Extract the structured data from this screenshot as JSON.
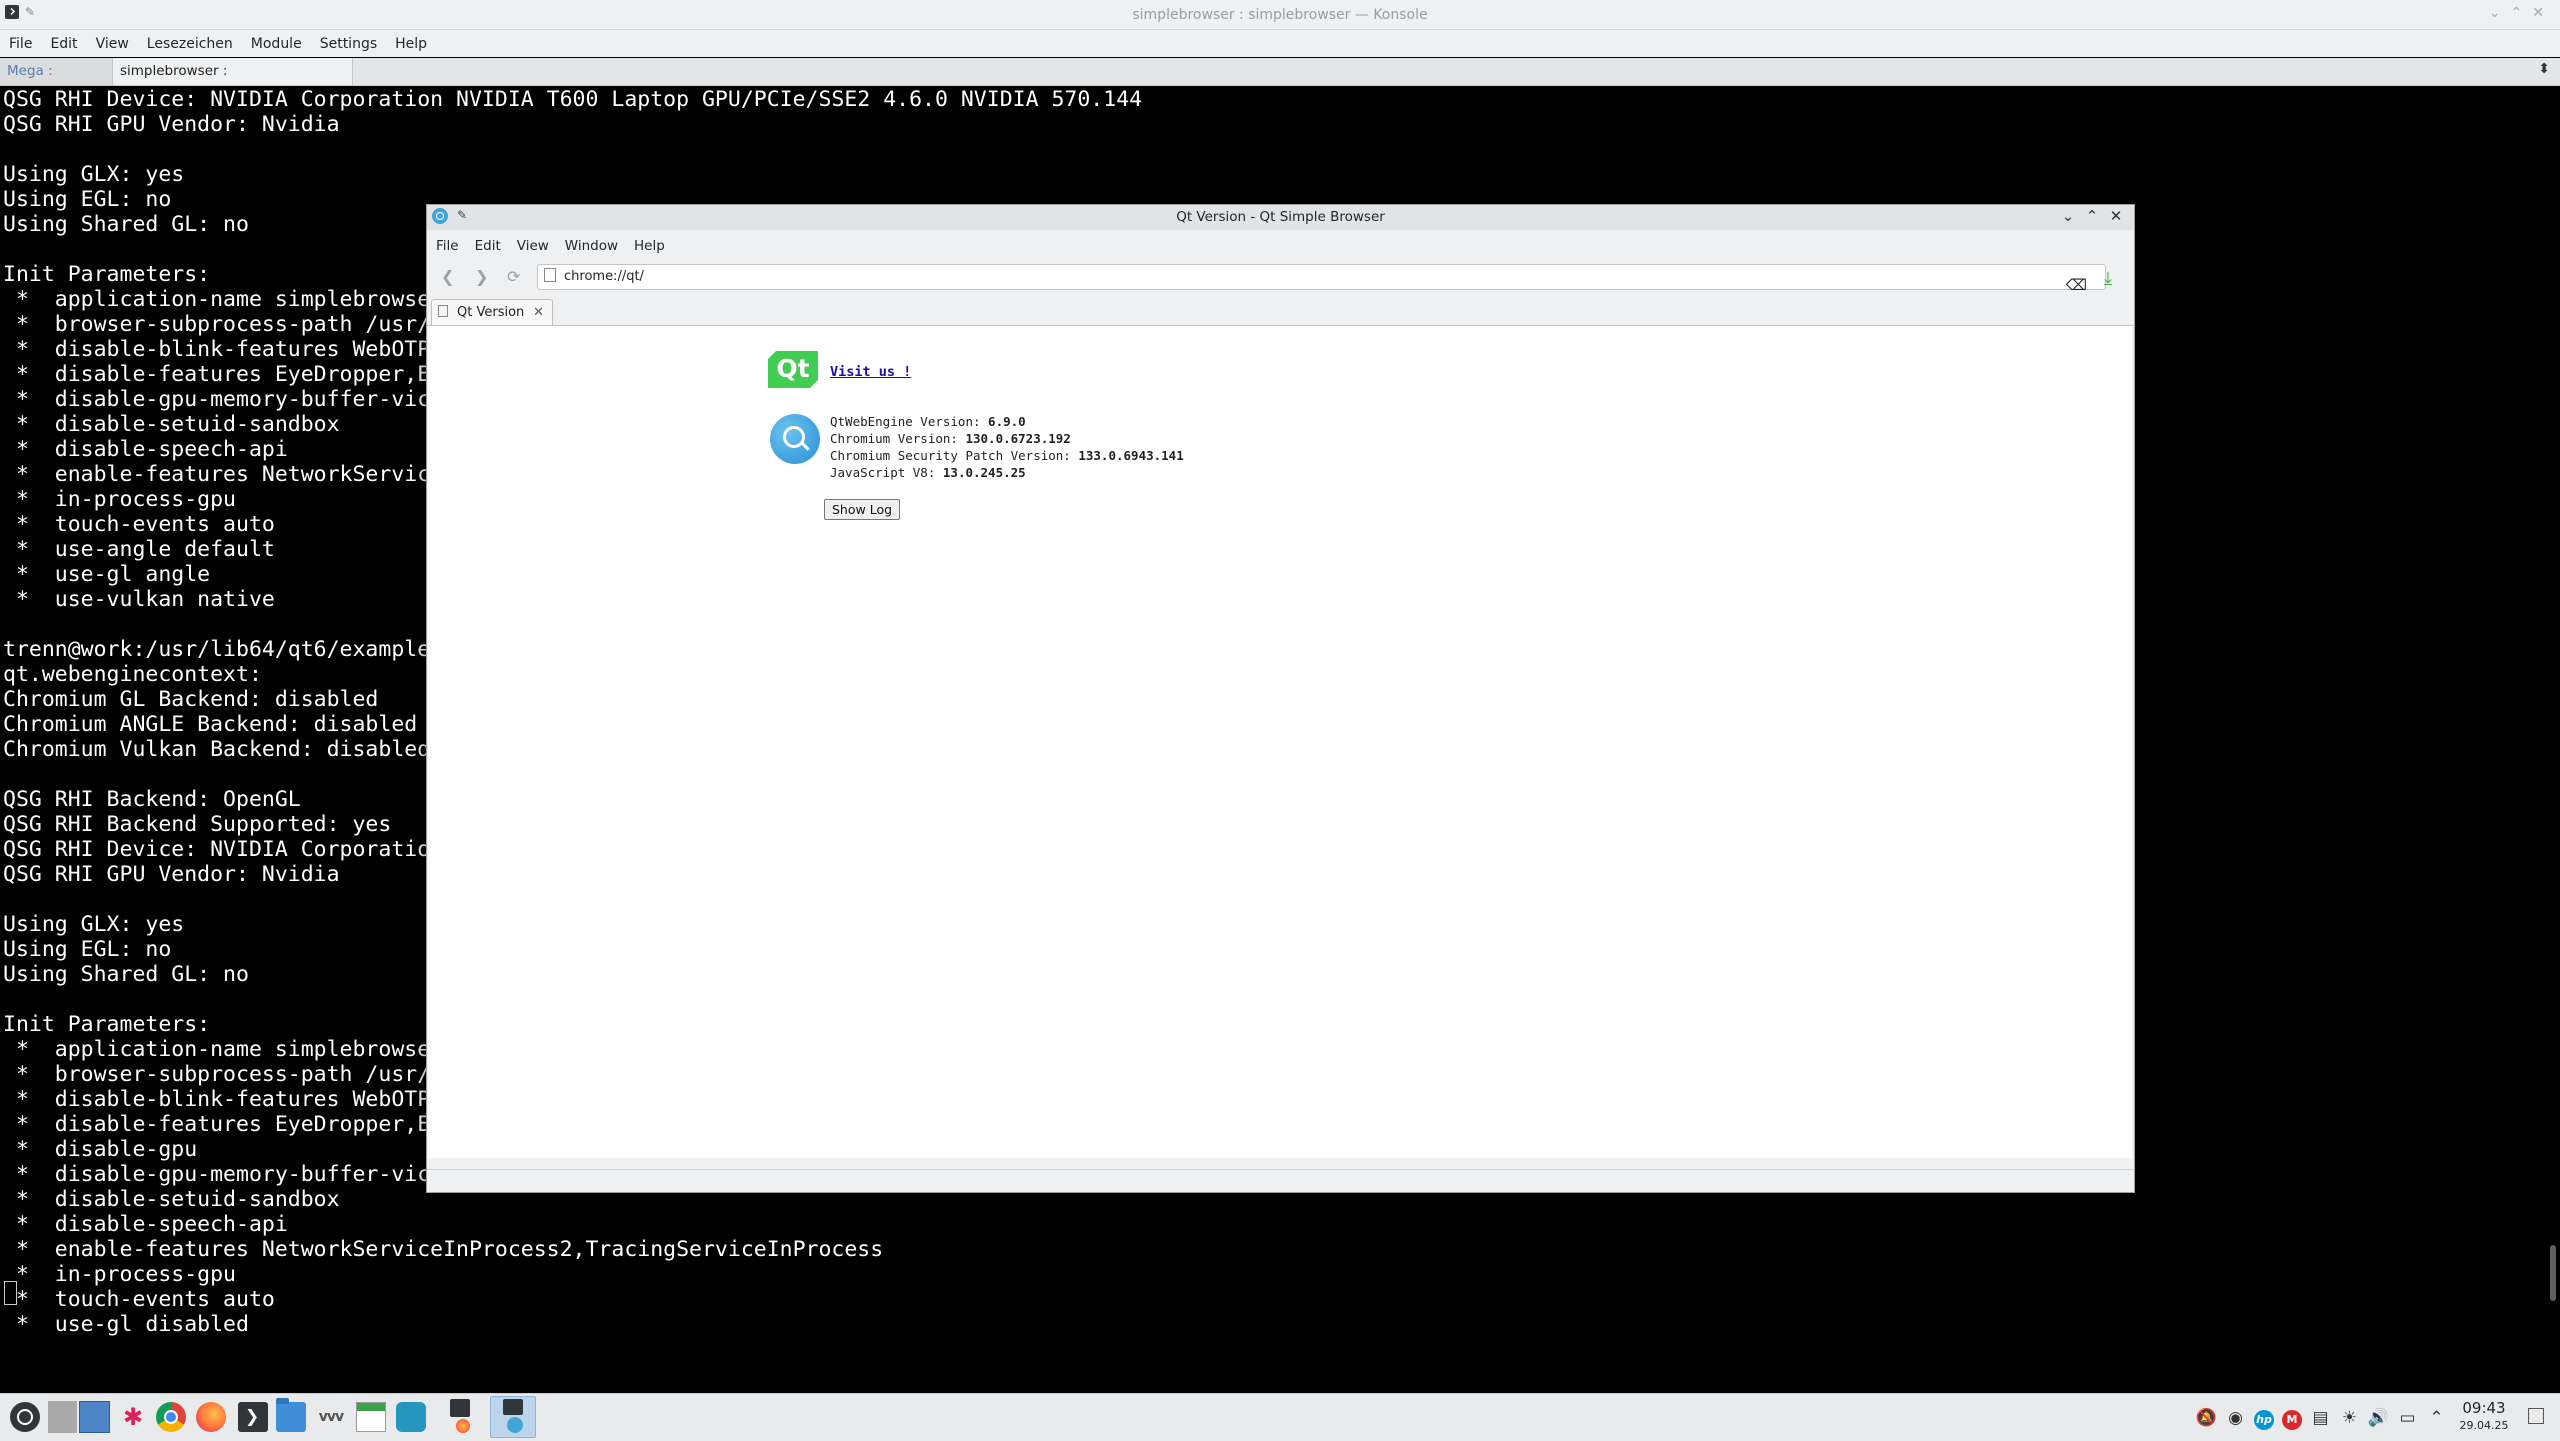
{
  "konsole": {
    "title": "simplebrowser : simplebrowser — Konsole",
    "menu": [
      "File",
      "Edit",
      "View",
      "Lesezeichen",
      "Module",
      "Settings",
      "Help"
    ],
    "tabs": [
      {
        "label": "Mega : kmail"
      },
      {
        "label": "simplebrowser : simplebrowser"
      }
    ],
    "terminal_lines": [
      "QSG RHI Device: NVIDIA Corporation NVIDIA T600 Laptop GPU/PCIe/SSE2 4.6.0 NVIDIA 570.144",
      "QSG RHI GPU Vendor: Nvidia",
      "",
      "Using GLX: yes",
      "Using EGL: no",
      "Using Shared GL: no",
      "",
      "Init Parameters:",
      " *  application-name simplebrowse",
      " *  browser-subprocess-path /usr/",
      " *  disable-blink-features WebOTP",
      " *  disable-features EyeDropper,E",
      " *  disable-gpu-memory-buffer-vic",
      " *  disable-setuid-sandbox",
      " *  disable-speech-api",
      " *  enable-features NetworkServic",
      " *  in-process-gpu",
      " *  touch-events auto",
      " *  use-angle default",
      " *  use-gl angle",
      " *  use-vulkan native",
      "",
      "trenn@work:/usr/lib64/qt6/example",
      "qt.webenginecontext:",
      "Chromium GL Backend: disabled",
      "Chromium ANGLE Backend: disabled",
      "Chromium Vulkan Backend: disabled",
      "",
      "QSG RHI Backend: OpenGL",
      "QSG RHI Backend Supported: yes",
      "QSG RHI Device: NVIDIA Corporatio",
      "QSG RHI GPU Vendor: Nvidia",
      "",
      "Using GLX: yes",
      "Using EGL: no",
      "Using Shared GL: no",
      "",
      "Init Parameters:",
      " *  application-name simplebrowse",
      " *  browser-subprocess-path /usr/",
      " *  disable-blink-features WebOTP",
      " *  disable-features EyeDropper,E",
      " *  disable-gpu",
      " *  disable-gpu-memory-buffer-vic",
      " *  disable-setuid-sandbox",
      " *  disable-speech-api",
      " *  enable-features NetworkServiceInProcess2,TracingServiceInProcess",
      " *  in-process-gpu",
      " *  touch-events auto",
      " *  use-gl disabled"
    ]
  },
  "browser": {
    "title": "Qt Version - Qt Simple Browser",
    "menu": [
      "File",
      "Edit",
      "View",
      "Window",
      "Help"
    ],
    "url": "chrome://qt/",
    "tab_label": "Qt Version",
    "page": {
      "logo_text": "Qt",
      "visit_link": "Visit us !",
      "versions": [
        {
          "label": "QtWebEngine Version:",
          "value": "6.9.0"
        },
        {
          "label": "Chromium Version:",
          "value": "130.0.6723.192"
        },
        {
          "label": "Chromium Security Patch Version:",
          "value": "133.0.6943.141"
        },
        {
          "label": "JavaScript V8:",
          "value": "13.0.245.25"
        }
      ],
      "show_log_label": "Show Log"
    }
  },
  "taskbar": {
    "clock_time": "09:43",
    "clock_date": "29.04.25",
    "icons": [
      "app-launcher-icon",
      "pager-icon",
      "slack-icon",
      "chrome-icon",
      "firefox-icon",
      "terminal-icon",
      "files-icon",
      "writer-icon",
      "calendar-icon",
      "kdeconnect-icon"
    ],
    "tray_icons": [
      "notifications-off-icon",
      "network-monitor-icon",
      "hp-icon",
      "mega-icon",
      "clipboard-icon",
      "brightness-icon",
      "volume-icon",
      "display-icon",
      "expand-tray-icon"
    ]
  },
  "colors": {
    "terminal_bg": "#000000",
    "terminal_fg": "#ffffff",
    "qt_green": "#41cd52",
    "link": "#1a0dab",
    "chrome_bg": "#eff0f1"
  }
}
